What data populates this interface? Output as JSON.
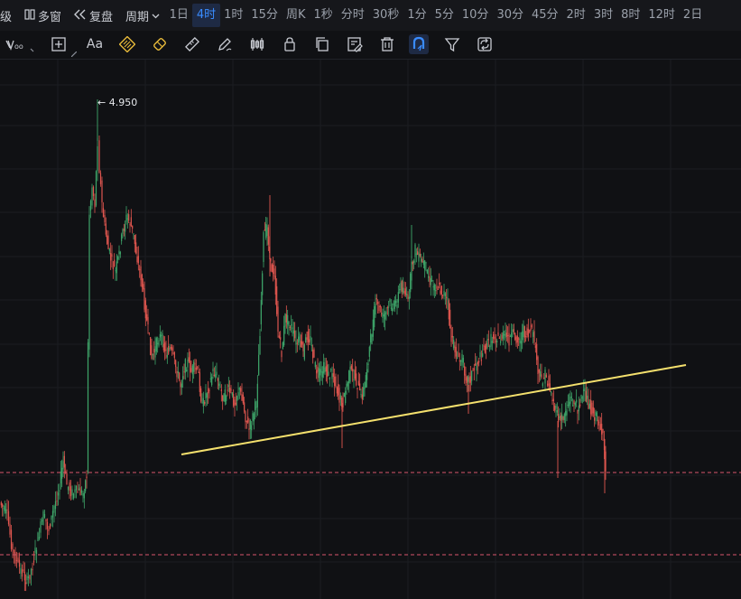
{
  "topbar": {
    "level_label": "级",
    "multi_window_label": "多窗",
    "restore_label": "复盘",
    "period_label": "周期",
    "periods": [
      "1日",
      "4时",
      "1时",
      "15分",
      "周K",
      "1秒",
      "分时",
      "30秒",
      "1分",
      "5分",
      "10分",
      "30分",
      "45分",
      "2时",
      "3时",
      "8时",
      "12时",
      "2日"
    ],
    "active_period": "4时"
  },
  "toolbar": {
    "text_tool_label": "Aa",
    "active_tool": "magnet-tool"
  },
  "chart": {
    "high_marker_label": "← 4.950",
    "up_color": "#3fa66a",
    "down_color": "#e0564f",
    "trendline_color": "#f4e06d",
    "dashed_line_color": "#d9556b"
  }
}
